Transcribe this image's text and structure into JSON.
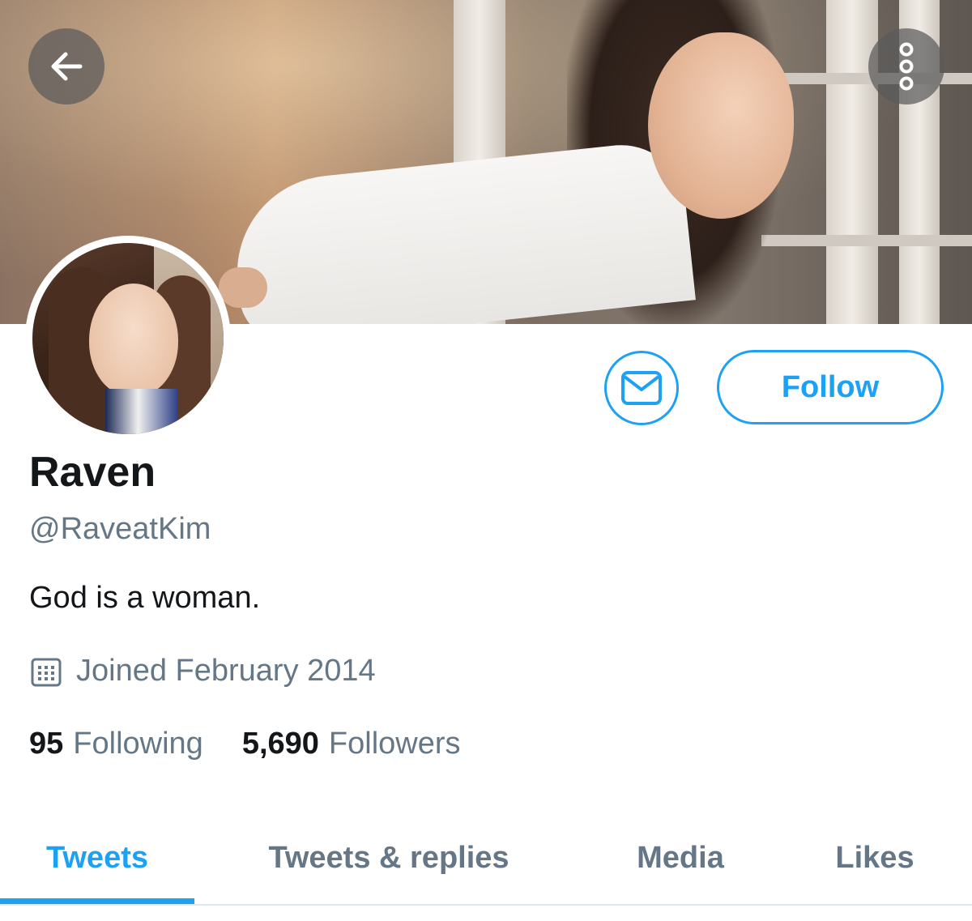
{
  "header": {
    "back_icon": "arrow-left-icon",
    "more_icon": "more-vertical-icon"
  },
  "profile": {
    "name": "Raven",
    "handle": "@RaveatKim",
    "bio": "God is a woman.",
    "joined": "Joined February 2014",
    "joined_icon": "calendar-icon"
  },
  "actions": {
    "message_icon": "envelope-icon",
    "follow_label": "Follow"
  },
  "stats": {
    "following_count": "95",
    "following_label": "Following",
    "followers_count": "5,690",
    "followers_label": "Followers"
  },
  "tabs": [
    {
      "label": "Tweets",
      "active": true
    },
    {
      "label": "Tweets & replies",
      "active": false
    },
    {
      "label": "Media",
      "active": false
    },
    {
      "label": "Likes",
      "active": false
    }
  ],
  "colors": {
    "accent": "#1da1f2",
    "text_primary": "#14171a",
    "text_secondary": "#657786",
    "divider": "#e1e8ed"
  }
}
